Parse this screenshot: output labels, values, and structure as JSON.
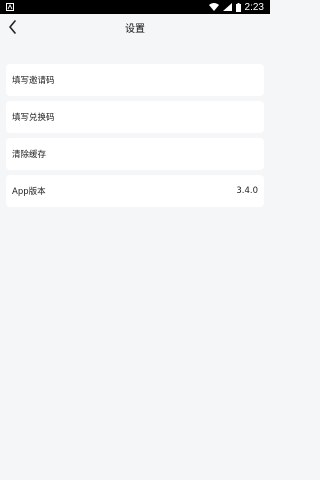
{
  "status_bar": {
    "time": "2:23",
    "icons": [
      "android-notification-icon",
      "wifi-icon",
      "signal-icon",
      "battery-icon"
    ]
  },
  "header": {
    "title": "设置",
    "back_icon": "chevron-left-icon"
  },
  "settings": {
    "items": [
      {
        "label": "填写邀请码",
        "value": ""
      },
      {
        "label": "填写兑换码",
        "value": ""
      },
      {
        "label": "清除缓存",
        "value": ""
      },
      {
        "label": "App版本",
        "value": "3.4.0"
      }
    ]
  },
  "colors": {
    "background": "#f5f6f8",
    "card": "#ffffff",
    "status_bar": "#000000"
  }
}
